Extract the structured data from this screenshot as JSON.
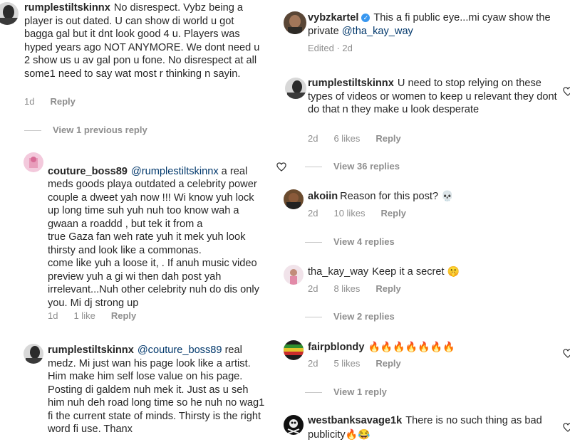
{
  "left": {
    "c1": {
      "username": "rumplestiltskinnx",
      "text": "No disrespect. Vybz being a player is out dated. U can show di world u got bagga gal but it dnt look good 4 u. Players was hyped years ago NOT ANYMORE. We dont need u 2 show us u av gal pon u fone. No disrespect at all some1 need to say wat most r thinking n sayin.",
      "time": "1d",
      "reply": "Reply"
    },
    "view_prev": "View 1 previous reply",
    "c2": {
      "username": "couture_boss89",
      "mention": "@rumplestiltskinnx",
      "text": " a real meds goods  playa outdated a celebrity power couple a dweet yah now !!! Wi know yuh lock up long time suh yuh nuh too know wah a gwaan a roaddd , but tek it from a\ntrue Gaza fan weh rate yuh it mek yuh look thirsty and look like a commonas.\ncome like yuh a loose it, . If anuh music video preview yuh a gi wi then dah post yah irrelevant...Nuh other celebrity nuh do dis only you. Mi dj strong up",
      "time": "1d",
      "likes": "1 like",
      "reply": "Reply"
    },
    "c3": {
      "username": "rumplestiltskinnx",
      "mention": "@couture_boss89",
      "text": " real medz. Mi just wan his page look like a artist. Him make him self lose value on his page. Posting di galdem nuh mek it. Just as u seh him nuh deh road long time so he nuh no wag1 fi the current state of minds. Thirsty is the right word fi use. Thanx"
    }
  },
  "right": {
    "caption": {
      "username": "vybzkartel",
      "text": "This a fi public eye...mi cyaw show the private ",
      "mention": "@tha_kay_way",
      "edited": "Edited · 2d"
    },
    "r1": {
      "username": "rumplestiltskinnx",
      "text": "U need to stop relying on these types of videos or women to keep u relevant they dont do that n they make u look desperate",
      "time": "2d",
      "likes": "6 likes",
      "reply": "Reply",
      "view_replies": "View 36 replies"
    },
    "r2": {
      "username": "akoiin",
      "text": "Reason for this post? ",
      "time": "2d",
      "likes": "10 likes",
      "reply": "Reply",
      "view_replies": "View 4 replies"
    },
    "r3": {
      "username": "tha_kay_way",
      "text": "Keep it a secret ",
      "time": "2d",
      "likes": "8 likes",
      "reply": "Reply",
      "view_replies": "View 2 replies"
    },
    "r4": {
      "username": "fairpblondy",
      "time": "2d",
      "likes": "5 likes",
      "reply": "Reply",
      "view_replies": "View 1 reply"
    },
    "r5": {
      "username": "westbanksavage1k",
      "text": "There is no such thing as bad publicity"
    }
  },
  "colors": {
    "text": "#262626",
    "meta": "#8e8e8e",
    "mention": "#00376b",
    "verified": "#3897f0"
  },
  "icons": {
    "heart": "heart-outline-icon",
    "verified": "verified-badge-icon",
    "skull": "skull-emoji",
    "shush": "shushing-face-emoji",
    "fire": "fire-emoji",
    "laugh": "tears-of-joy-emoji"
  }
}
